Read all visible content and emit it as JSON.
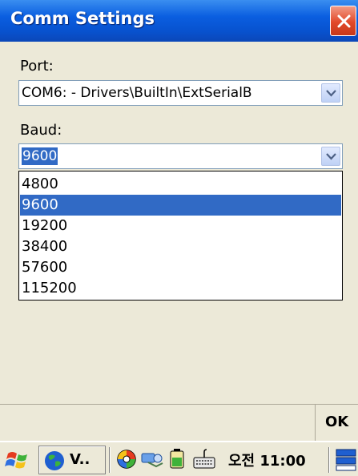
{
  "window": {
    "title": "Comm Settings",
    "close_icon": "close-x-icon",
    "colors": {
      "titlebar": "#0852cf",
      "close": "#e2492a",
      "selection": "#316ac5"
    }
  },
  "port": {
    "label": "Port:",
    "value": "COM6: - Drivers\\BuiltIn\\ExtSerialB"
  },
  "baud": {
    "label": "Baud:",
    "value": "9600",
    "options": [
      "4800",
      "9600",
      "19200",
      "38400",
      "57600",
      "115200"
    ],
    "selected_index": 1
  },
  "bottom": {
    "ok_label": "OK"
  },
  "taskbar": {
    "start_icon": "windows-flag-icon",
    "task_label": "V..",
    "task_icon": "globe-icon",
    "tray_icons": [
      "color-wheel-icon",
      "network-icon",
      "battery-icon",
      "keyboard-icon"
    ],
    "clock": "오전 11:00",
    "desktop_icon": "desktop-icon"
  }
}
